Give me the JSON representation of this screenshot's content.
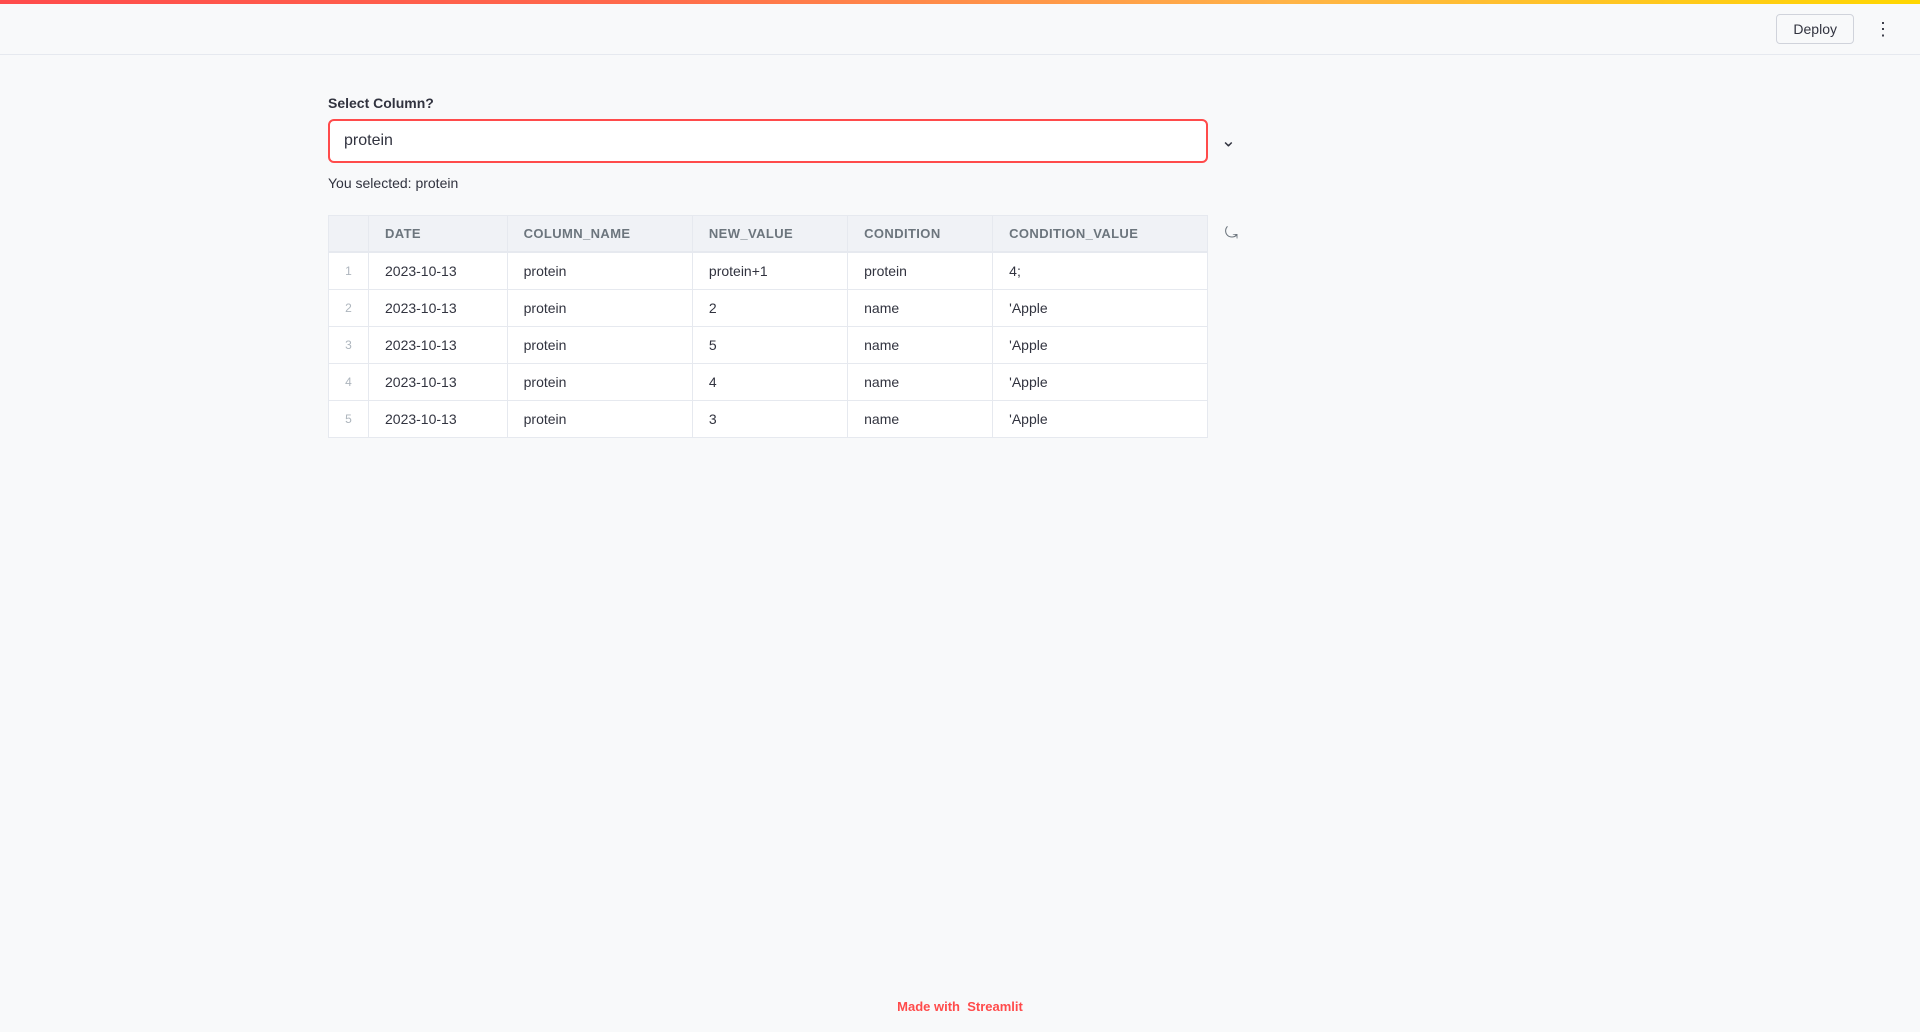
{
  "topbar": {
    "gradient": "linear-gradient(to right, #ff4b4b, #ff6a4b, #ffb347, #ffd700)"
  },
  "header": {
    "deploy_label": "Deploy",
    "menu_icon": "⋮"
  },
  "form": {
    "select_label": "Select Column?",
    "select_value": "protein",
    "selected_text": "You selected: protein",
    "chevron_icon": "⌄"
  },
  "table": {
    "columns": [
      {
        "key": "index",
        "label": ""
      },
      {
        "key": "date",
        "label": "DATE"
      },
      {
        "key": "column_name",
        "label": "COLUMN_NAME"
      },
      {
        "key": "new_value",
        "label": "NEW_VALUE"
      },
      {
        "key": "condition",
        "label": "CONDITION"
      },
      {
        "key": "condition_value",
        "label": "CONDITION_VALUE"
      }
    ],
    "rows": [
      {
        "index": "1",
        "date": "2023-10-13",
        "column_name": "protein",
        "new_value": "protein+1",
        "condition": "protein",
        "condition_value": "4;"
      },
      {
        "index": "2",
        "date": "2023-10-13",
        "column_name": "protein",
        "new_value": "2",
        "condition": "name",
        "condition_value": "'Apple"
      },
      {
        "index": "3",
        "date": "2023-10-13",
        "column_name": "protein",
        "new_value": "5",
        "condition": "name",
        "condition_value": "'Apple"
      },
      {
        "index": "4",
        "date": "2023-10-13",
        "column_name": "protein",
        "new_value": "4",
        "condition": "name",
        "condition_value": "'Apple"
      },
      {
        "index": "5",
        "date": "2023-10-13",
        "column_name": "protein",
        "new_value": "3",
        "condition": "name",
        "condition_value": "'Apple"
      }
    ]
  },
  "footer": {
    "made_with_text": "Made with",
    "brand_name": "Streamlit"
  }
}
